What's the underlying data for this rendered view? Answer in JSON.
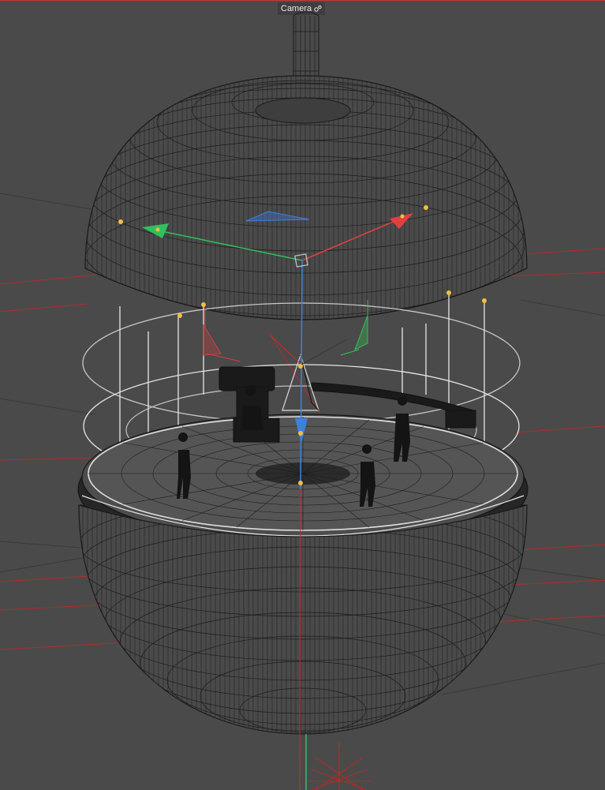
{
  "viewport": {
    "camera_label": "Camera",
    "camera_icon": "camera-options-icon"
  },
  "colors": {
    "background": "#4a4a4a",
    "grid": "#3a3a3a",
    "red_lines": "#b82a2a",
    "wireframe": "#1e1e1e",
    "handle_yellow": "#f0c040",
    "axis_x": "#e04040",
    "axis_y": "#30c060",
    "axis_z": "#3080e0",
    "white_wire": "#e6e6e6"
  }
}
